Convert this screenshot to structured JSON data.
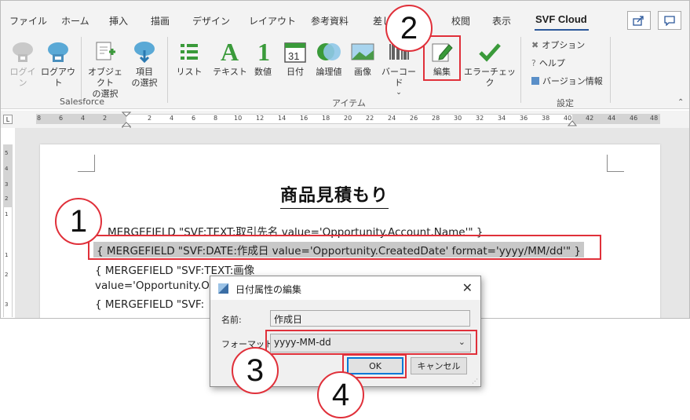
{
  "tabs": [
    {
      "label": "ファイル"
    },
    {
      "label": "ホーム"
    },
    {
      "label": "挿入"
    },
    {
      "label": "描画"
    },
    {
      "label": "デザイン"
    },
    {
      "label": "レイアウト"
    },
    {
      "label": "参考資料"
    },
    {
      "label": "差し"
    },
    {
      "label": "校閲"
    },
    {
      "label": "表示"
    },
    {
      "label": "SVF Cloud"
    }
  ],
  "ribbon": {
    "login": "ログイン",
    "logout": "ログアウト",
    "select_object": "オブジェクト\nの選択",
    "select_item": "項目\nの選択",
    "list": "リスト",
    "text": "テキスト",
    "number": "数値",
    "date": "日付",
    "logical": "論理値",
    "image": "画像",
    "barcode": "バーコード",
    "edit": "編集",
    "error_check": "エラーチェック",
    "option": "オプション",
    "help": "ヘルプ",
    "version": "バージョン情報",
    "group_salesforce": "Salesforce",
    "group_item": "アイテム",
    "group_settings": "設定",
    "date_icon_text": "31"
  },
  "ruler": {
    "ticks": [
      "8",
      "6",
      "4",
      "2",
      "2",
      "4",
      "6",
      "8",
      "10",
      "12",
      "14",
      "16",
      "18",
      "20",
      "22",
      "24",
      "26",
      "28",
      "30",
      "32",
      "34",
      "36",
      "38",
      "40",
      "42",
      "44",
      "46",
      "48"
    ],
    "tab_marker": "L",
    "vticks": [
      "5",
      "4",
      "3",
      "2",
      "1",
      "1",
      "2",
      "3"
    ]
  },
  "document": {
    "title": "商品見積もり",
    "line1": "MERGEFIELD \"SVF:TEXT:取引先名  value='Opportunity.Account.Name'\"  }",
    "line2": "{  MERGEFIELD \"SVF:DATE:作成日  value='Opportunity.CreatedDate' format='yyyy/MM/dd'\"  }",
    "line3": "{  MERGEFIELD \"SVF:TEXT:画像",
    "line4": "value='Opportunity.O",
    "line5": "{  MERGEFIELD \"SVF:"
  },
  "dialog": {
    "title": "日付属性の編集",
    "name_label": "名前:",
    "name_value": "作成日",
    "format_label": "フォーマット:",
    "format_value": "yyyy-MM-dd",
    "ok": "OK",
    "cancel": "キャンセル"
  },
  "callouts": [
    "1",
    "2",
    "3",
    "4"
  ],
  "colors": {
    "accent_red": "#e0303a",
    "ribbon_bg": "#f3f3f3",
    "svf_blue": "#2b579a",
    "green": "#3a9a3a"
  }
}
